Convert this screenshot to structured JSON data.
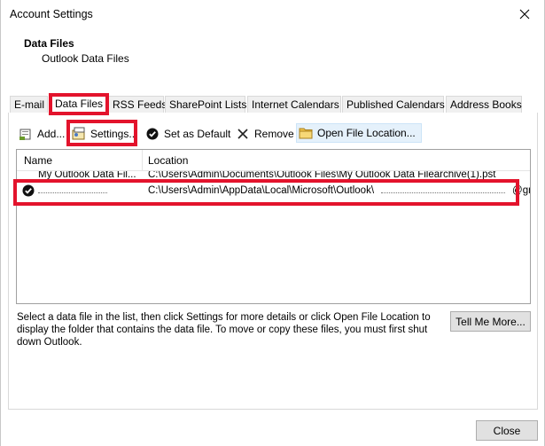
{
  "window": {
    "title": "Account Settings"
  },
  "header": {
    "title": "Data Files",
    "subtitle": "Outlook Data Files"
  },
  "tabs": [
    {
      "label": "E-mail"
    },
    {
      "label": "Data Files"
    },
    {
      "label": "RSS Feeds"
    },
    {
      "label": "SharePoint Lists"
    },
    {
      "label": "Internet Calendars"
    },
    {
      "label": "Published Calendars"
    },
    {
      "label": "Address Books"
    }
  ],
  "active_tab": "Data Files",
  "toolbar": {
    "add_label": "Add...",
    "settings_label": "Settings...",
    "default_label": "Set as Default",
    "remove_label": "Remove",
    "open_location_label": "Open File Location..."
  },
  "list": {
    "columns": {
      "name": "Name",
      "location": "Location"
    },
    "rows": [
      {
        "name": "My Outlook Data Fil...",
        "location": "C:\\Users\\Admin\\Documents\\Outlook Files\\My Outlook Data Filearchive(1).pst"
      },
      {
        "name": "",
        "location_prefix": "C:\\Users\\Admin\\AppData\\Local\\Microsoft\\Outlook\\",
        "location_suffix": "@gmail.com ...",
        "is_default": true
      }
    ]
  },
  "description": "Select a data file in the list, then click Settings for more details or click Open File Location to display the folder that contains the data file. To move or copy these files, you must first shut down Outlook.",
  "buttons": {
    "tell_me_more": "Tell Me More...",
    "close": "Close"
  },
  "highlight_color": "#e3132c"
}
